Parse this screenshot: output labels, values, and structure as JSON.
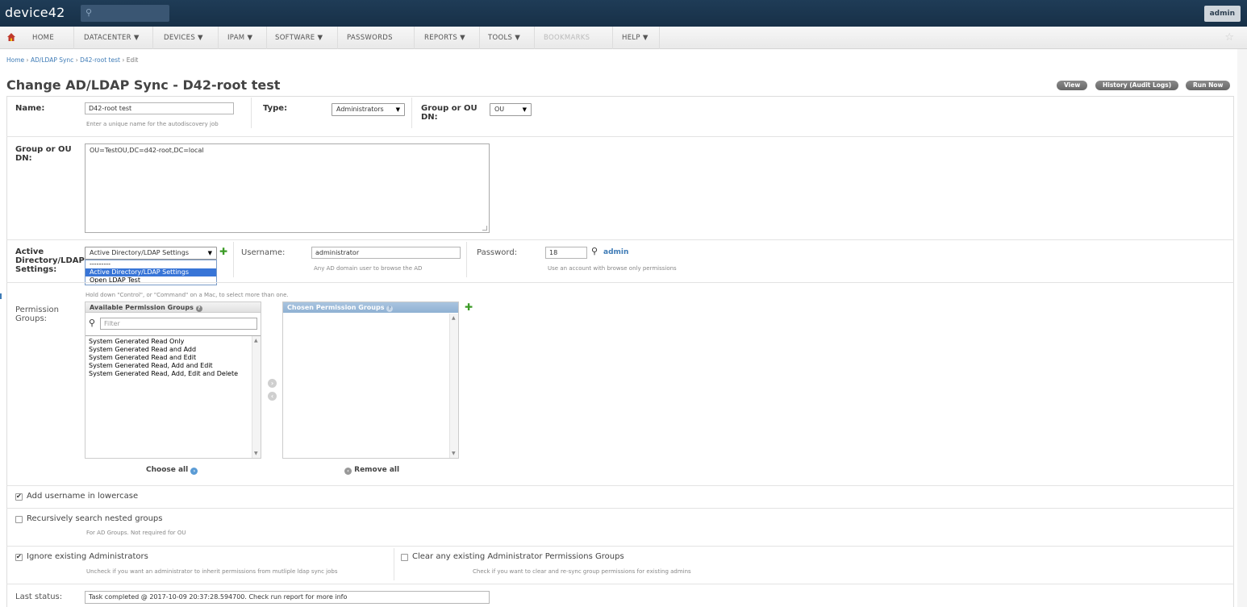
{
  "app": {
    "logo": "device42",
    "user": "admin"
  },
  "nav": {
    "items": [
      {
        "label": "HOME"
      },
      {
        "label": "DATACENTER ▼"
      },
      {
        "label": "DEVICES ▼"
      },
      {
        "label": "IPAM ▼"
      },
      {
        "label": "SOFTWARE ▼"
      },
      {
        "label": "PASSWORDS"
      },
      {
        "label": "REPORTS ▼"
      },
      {
        "label": "TOOLS ▼"
      },
      {
        "label": "BOOKMARKS"
      },
      {
        "label": "HELP ▼"
      }
    ]
  },
  "breadcrumb": {
    "home": "Home",
    "section": "AD/LDAP Sync",
    "item": "D42-root test",
    "current": "Edit",
    "sep": " › "
  },
  "page": {
    "title": "Change AD/LDAP Sync - D42-root test",
    "buttons": {
      "view": "View",
      "history": "History (Audit Logs)",
      "run": "Run Now"
    }
  },
  "form": {
    "name_label": "Name:",
    "name_value": "D42-root test",
    "name_help": "Enter a unique name for the autodiscovery job",
    "type_label": "Type:",
    "type_value": "Administrators",
    "group_ou_dn_label": "Group or OU DN:",
    "group_ou_dn_value": "OU",
    "dn_label": "Group or OU DN:",
    "dn_value": "OU=TestOU,DC=d42-root,DC=local",
    "ad_label": "Active Directory/LDAP Settings:",
    "ad_value": "Active Directory/LDAP Settings",
    "ad_options": [
      "---------",
      "Active Directory/LDAP Settings",
      "Open LDAP Test"
    ],
    "username_label": "Username:",
    "username_value": "administrator",
    "username_help": "Any AD domain user to browse the AD",
    "password_label": "Password:",
    "password_value": "18",
    "password_user": "admin",
    "password_help": "Use an account with browse only permissions",
    "multi_help": "Hold down \"Control\", or \"Command\" on a Mac, to select more than one.",
    "perm_label": "Permission Groups:",
    "available_title": "Available Permission Groups",
    "chosen_title": "Chosen Permission Groups",
    "filter_placeholder": "Filter",
    "available_items": [
      "System Generated Read Only",
      "System Generated Read and Add",
      "System Generated Read and Edit",
      "System Generated Read, Add and Edit",
      "System Generated Read, Add, Edit and Delete"
    ],
    "choose_all": "Choose all",
    "remove_all": "Remove all",
    "lowercase_label": "Add username in lowercase",
    "lowercase_checked": true,
    "recursive_label": "Recursively search nested groups",
    "recursive_checked": false,
    "recursive_help": "For AD Groups. Not required for OU",
    "ignore_label": "Ignore existing Administrators",
    "ignore_checked": true,
    "ignore_help": "Uncheck if you want an administrator to inherit permissions from mutliple ldap sync jobs",
    "clear_label": "Clear any existing Administrator Permissions Groups",
    "clear_checked": false,
    "clear_help": "Check if you want to clear and re-sync group permissions for existing admins",
    "last_status_label": "Last status:",
    "last_status_value": "Task completed @ 2017-10-09 20:37:28.594700. Check run report for more info"
  }
}
